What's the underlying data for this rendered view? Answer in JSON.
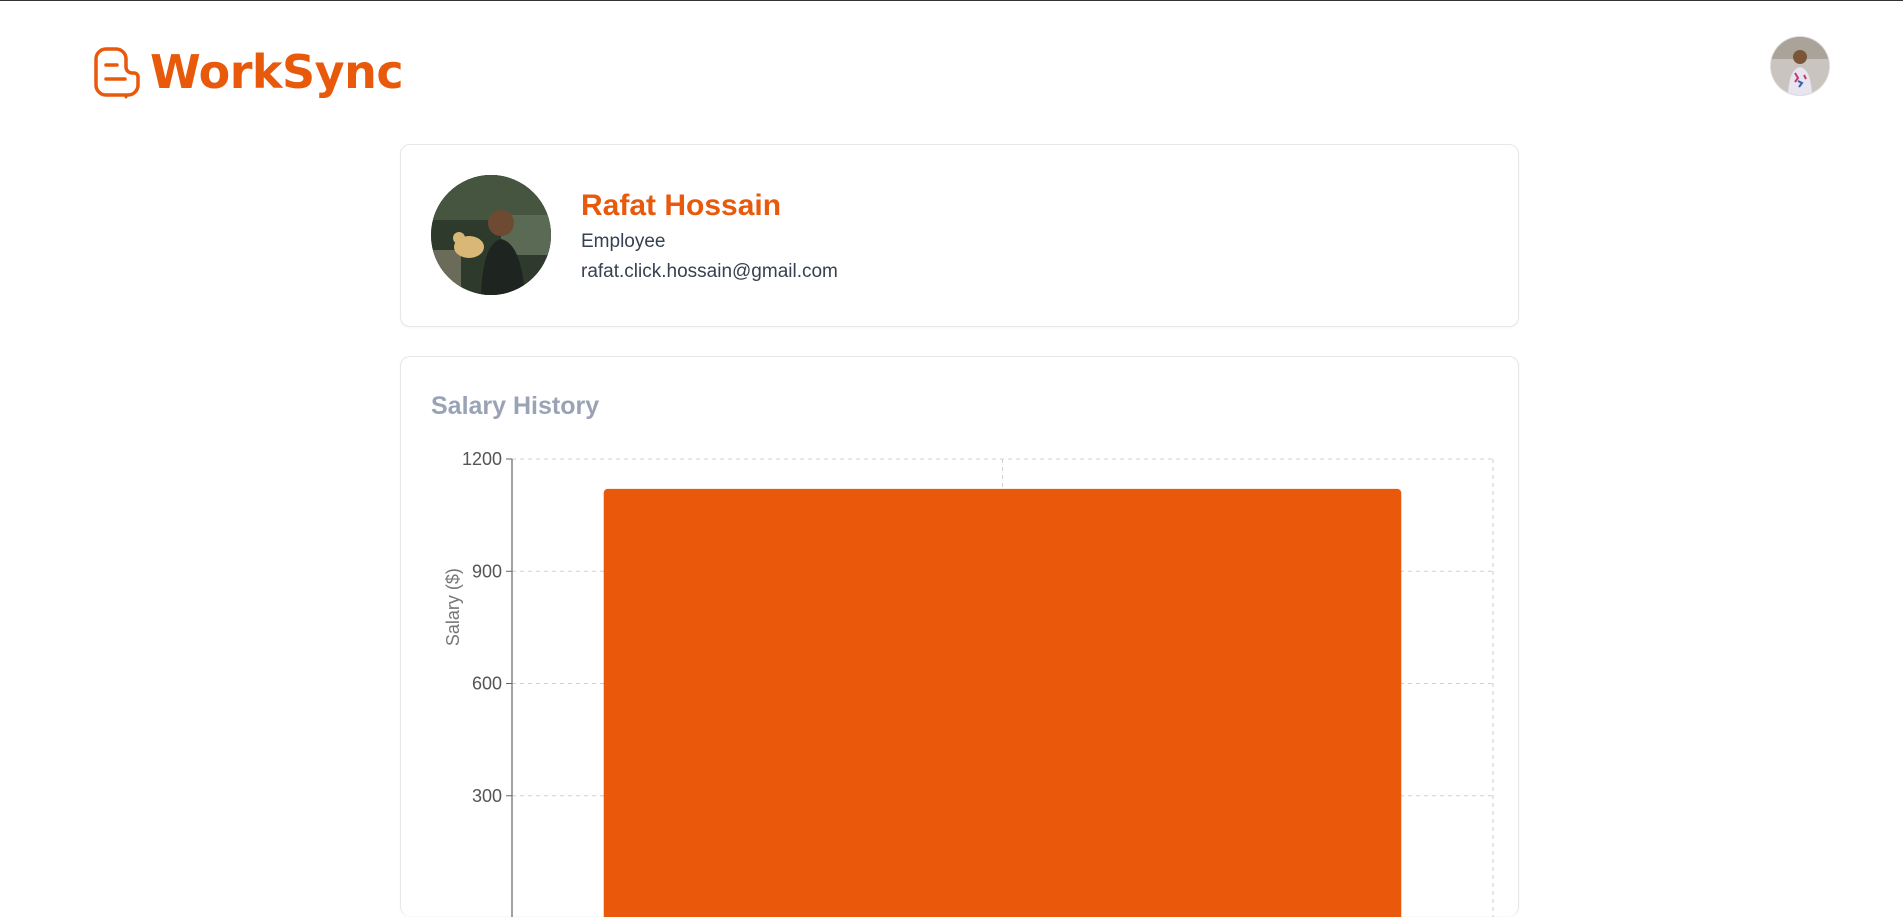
{
  "app": {
    "brand": "WorkSync",
    "brand_color": "#e8590c",
    "logo_icon": "blog-icon"
  },
  "header": {
    "avatar_icon": "user-avatar"
  },
  "profile": {
    "name": "Rafat Hossain",
    "role": "Employee",
    "email": "rafat.click.hossain@gmail.com"
  },
  "salary_history": {
    "title": "Salary History"
  },
  "chart_data": {
    "type": "bar",
    "title": "Salary History",
    "ylabel": "Salary ($)",
    "xlabel": "",
    "ylim": [
      0,
      1200
    ],
    "yticks": [
      300,
      600,
      900,
      1200
    ],
    "categories": [
      ""
    ],
    "values": [
      1120
    ],
    "bar_color": "#ea580c",
    "grid": true
  }
}
